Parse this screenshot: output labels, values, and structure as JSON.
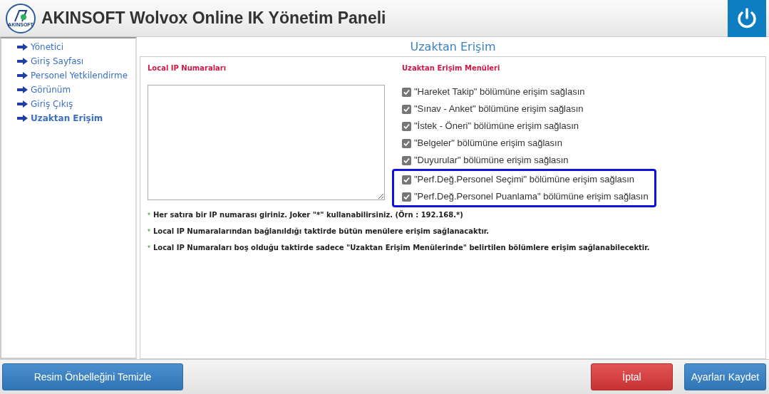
{
  "header": {
    "title": "AKINSOFT Wolvox Online IK Yönetim Paneli",
    "logo_text": "AKINSOFT"
  },
  "sidebar": {
    "items": [
      {
        "label": "Yönetici",
        "selected": false
      },
      {
        "label": "Giriş Sayfası",
        "selected": false
      },
      {
        "label": "Personel Yetkilendirme",
        "selected": false
      },
      {
        "label": "Görünüm",
        "selected": false
      },
      {
        "label": "Giriş Çıkış",
        "selected": false
      },
      {
        "label": "Uzaktan Erişim",
        "selected": true
      }
    ]
  },
  "page_title": "Uzaktan Erişim",
  "ip_section": {
    "heading": "Local IP Numaraları"
  },
  "menu_section": {
    "heading": "Uzaktan Erişim Menüleri",
    "items": [
      {
        "label": "\"Hareket Takip\" bölümüne erişim sağlasın",
        "checked": true,
        "highlighted": false
      },
      {
        "label": "\"Sınav - Anket\" bölümüne erişim sağlasın",
        "checked": true,
        "highlighted": false
      },
      {
        "label": "\"İstek - Öneri\" bölümüne erişim sağlasın",
        "checked": true,
        "highlighted": false
      },
      {
        "label": "\"Belgeler\" bölümüne erişim sağlasın",
        "checked": true,
        "highlighted": false
      },
      {
        "label": "\"Duyurular\" bölümüne erişim sağlasın",
        "checked": true,
        "highlighted": false
      },
      {
        "label": "\"Perf.Değ.Personel Seçimi\" bölümüne erişim sağlasın",
        "checked": true,
        "highlighted": true
      },
      {
        "label": "\"Perf.Değ.Personel Puanlama\" bölümüne erişim sağlasın",
        "checked": true,
        "highlighted": true
      }
    ]
  },
  "notes": [
    {
      "bullet": "*",
      "text": "Her satıra bir IP numarası giriniz. Joker \"*\" kullanabilirsiniz. (Örn : 192.168.*)"
    },
    {
      "bullet": "*",
      "text": "Local IP Numaralarından bağlanıldığı taktirde bütün menülere erişim sağlanacaktır."
    },
    {
      "bullet": "*",
      "text": "Local IP Numaraları boş olduğu taktirde sadece \"Uzaktan Erişim Menülerinde\" belirtilen bölümlere erişim sağlanabilecektir."
    }
  ],
  "footer": {
    "buttons": [
      {
        "label": "Resim Önbelleğini Temizle",
        "kind": "primary"
      },
      {
        "label": "İptal",
        "kind": "danger"
      },
      {
        "label": "Ayarları Kaydet",
        "kind": "primary"
      }
    ]
  }
}
